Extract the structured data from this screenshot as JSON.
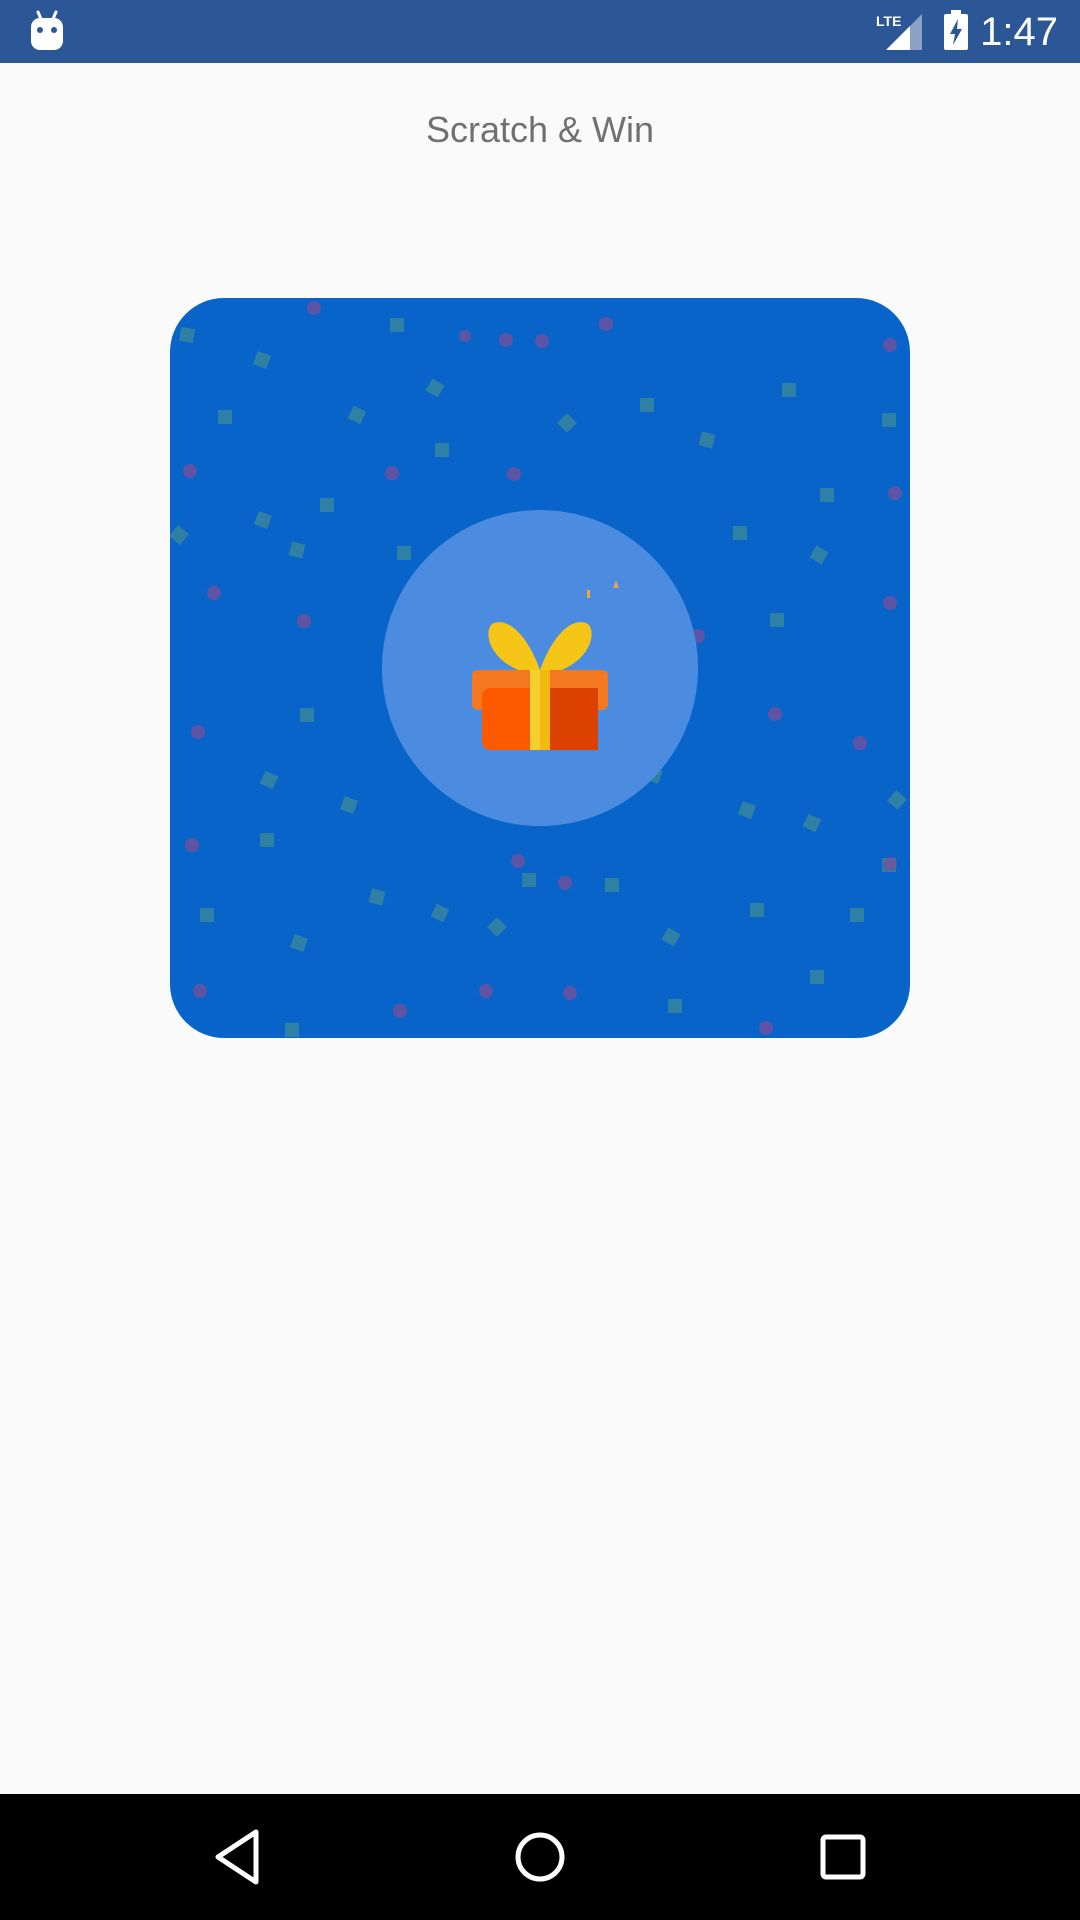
{
  "status_bar": {
    "time": "1:47",
    "network_label": "LTE",
    "icons": [
      "android-icon",
      "lte-signal-icon",
      "battery-charging-icon"
    ],
    "background_color": "#2b5797"
  },
  "header": {
    "title": "Scratch & Win"
  },
  "scratch_card": {
    "background_color": "#0864c8",
    "icon": "gift-icon"
  },
  "nav_bar": {
    "buttons": [
      "back-icon",
      "home-icon",
      "recent-apps-icon"
    ]
  }
}
